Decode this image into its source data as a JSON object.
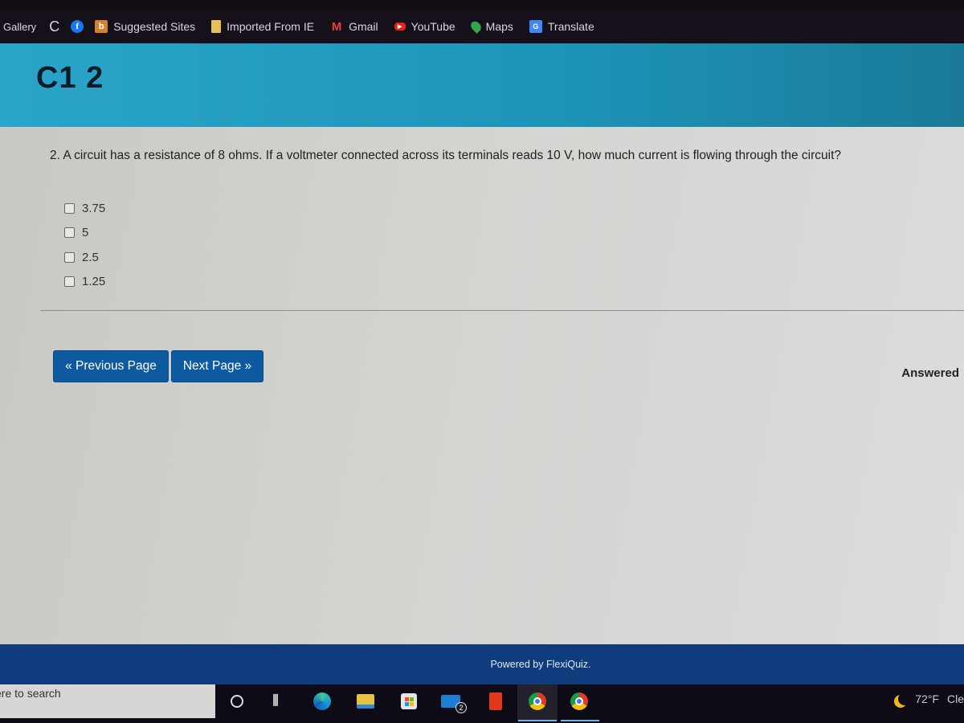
{
  "browser": {
    "bookmarks": [
      {
        "label": "Gallery",
        "icon": "gallery-text"
      },
      {
        "label": "",
        "icon": "c-letter-icon"
      },
      {
        "label": "",
        "icon": "facebook-icon"
      },
      {
        "label": "Suggested Sites",
        "icon": "suggested-sites-icon"
      },
      {
        "label": "Imported From IE",
        "icon": "folder-icon"
      },
      {
        "label": "Gmail",
        "icon": "gmail-icon"
      },
      {
        "label": "YouTube",
        "icon": "youtube-icon"
      },
      {
        "label": "Maps",
        "icon": "maps-pin-icon"
      },
      {
        "label": "Translate",
        "icon": "translate-icon"
      }
    ]
  },
  "quiz": {
    "title": "C1 2",
    "question": "2. A circuit has a resistance of 8 ohms. If a voltmeter connected across its terminals reads 10 V, how much current is flowing through the circuit?",
    "options": [
      {
        "label": "3.75",
        "checked": false
      },
      {
        "label": "5",
        "checked": false
      },
      {
        "label": "2.5",
        "checked": false
      },
      {
        "label": "1.25",
        "checked": false
      }
    ],
    "prev_button": "« Previous Page",
    "next_button": "Next Page »",
    "status": "Answered",
    "footer": "Powered by FlexiQuiz."
  },
  "taskbar": {
    "search_text": "ere to search",
    "mail_badge": "2",
    "weather_temp": "72°F",
    "weather_desc": "Cle"
  },
  "colors": {
    "header": "#1d93b8",
    "button": "#0d5aa0",
    "footer": "#0f3c7d"
  }
}
